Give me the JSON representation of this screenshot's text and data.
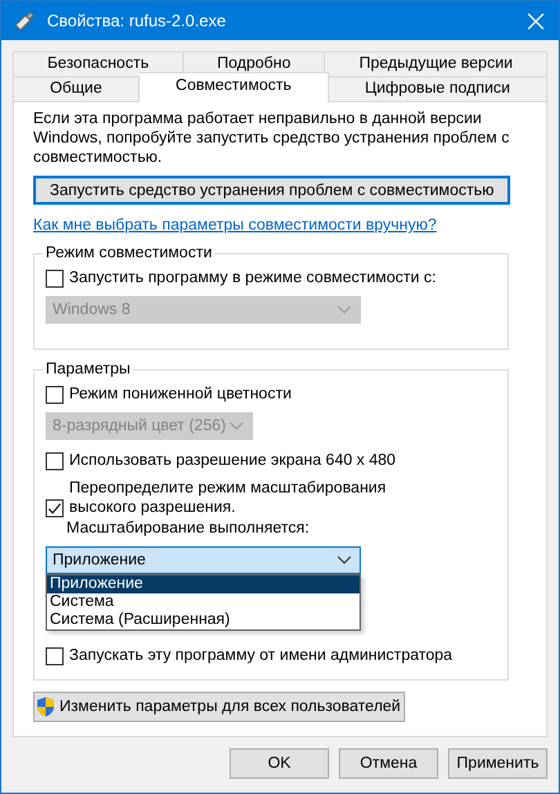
{
  "window": {
    "title": "Свойства: rufus-2.0.exe"
  },
  "tab_rows": [
    {
      "tabs": [
        {
          "label": "Безопасность",
          "selected": false
        },
        {
          "label": "Подробно",
          "selected": false
        },
        {
          "label": "Предыдущие версии",
          "selected": false
        }
      ]
    },
    {
      "tabs": [
        {
          "label": "Общие",
          "selected": false
        },
        {
          "label": "Совместимость",
          "selected": true
        },
        {
          "label": "Цифровые подписи",
          "selected": false
        }
      ]
    }
  ],
  "intro": "Если эта программа работает неправильно в данной версии Windows, попробуйте запустить средство устранения проблем с совместимостью.",
  "troubleshoot_button": "Запустить средство устранения проблем с совместимостью",
  "help_link": "Как мне выбрать параметры совместимости вручную?",
  "compat_group": {
    "title": "Режим совместимости",
    "checkbox": {
      "label": "Запустить программу в режиме совместимости с:",
      "checked": false
    },
    "select": {
      "value": "Windows 8",
      "disabled": true
    }
  },
  "settings_group": {
    "title": "Параметры",
    "items": [
      {
        "kind": "checkbox",
        "label": "Режим пониженной цветности",
        "checked": false
      },
      {
        "kind": "select",
        "value": "8-разрядный цвет (256)",
        "disabled": true
      },
      {
        "kind": "checkbox",
        "label": "Использовать разрешение экрана 640 x 480",
        "checked": false
      },
      {
        "kind": "dpi",
        "label": "Переопределите режим масштабирования высокого разрешения.",
        "checked": true,
        "sublabel": "Масштабирование выполняется:",
        "select": {
          "value": "Приложение",
          "expanded": true,
          "options": [
            {
              "label": "Приложение",
              "selected": true
            },
            {
              "label": "Система",
              "selected": false
            },
            {
              "label": "Система (Расширенная)",
              "selected": false
            }
          ]
        }
      },
      {
        "kind": "checkbox",
        "label": "Запускать эту программу от имени администратора",
        "checked": false
      }
    ]
  },
  "all_users_button": "Изменить параметры для всех пользователей",
  "buttons": [
    {
      "label": "OK"
    },
    {
      "label": "Отмена"
    },
    {
      "label": "Применить"
    }
  ]
}
